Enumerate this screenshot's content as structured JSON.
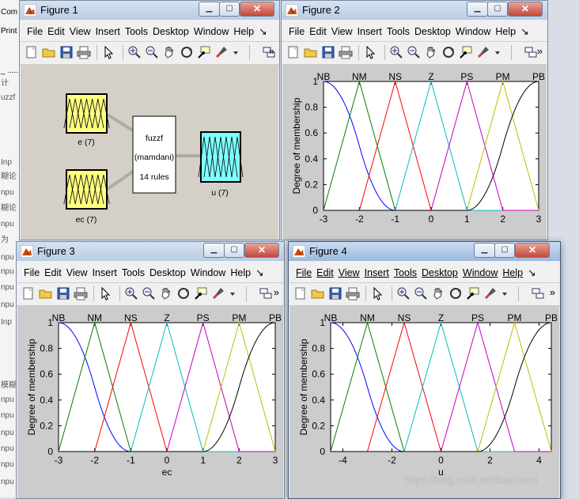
{
  "background": {
    "fragments": [
      "Com",
      "Print",
      "_ .....",
      "计",
      "uzzf",
      "Inp",
      "糊论",
      "npu",
      "糊论",
      "npu",
      "为",
      "npu",
      "npu",
      "npu",
      "npu",
      "Inp",
      "模糊",
      "npu",
      "npu",
      "npu",
      "npu",
      "npu",
      "npu"
    ]
  },
  "menu_items": [
    "File",
    "Edit",
    "View",
    "Insert",
    "Tools",
    "Desktop",
    "Window",
    "Help"
  ],
  "menu_overflow": "↘",
  "toolbar_overflow": "»",
  "windows": {
    "figure1": {
      "title": "Figure 1"
    },
    "figure2": {
      "title": "Figure 2"
    },
    "figure3": {
      "title": "Figure 3"
    },
    "figure4": {
      "title": "Figure 4"
    }
  },
  "fis_diagram": {
    "input1_label": "e (7)",
    "input2_label": "ec (7)",
    "system_name": "fuzzf",
    "system_type": "(mamdani)",
    "rules": "14 rules",
    "output_label": "u (7)",
    "input_color": "#ffff80",
    "output_color": "#80ffff"
  },
  "chart_data": [
    {
      "type": "line",
      "figure": "Figure 2",
      "xlabel": "",
      "ylabel": "Degree of membership",
      "xlim": [
        -3,
        3
      ],
      "ylim": [
        0,
        1
      ],
      "xticks": [
        "-3",
        "-2",
        "-1",
        "0",
        "1",
        "2",
        "3"
      ],
      "yticks": [
        "0",
        "0.2",
        "0.4",
        "0.6",
        "0.8",
        "1"
      ],
      "grid": false,
      "series": [
        {
          "name": "NB",
          "color": "#0000ff",
          "shape": "zmf",
          "params": [
            -3,
            -1
          ]
        },
        {
          "name": "NM",
          "color": "#008000",
          "shape": "trimf",
          "params": [
            -3,
            -2,
            -1
          ]
        },
        {
          "name": "NS",
          "color": "#ff0000",
          "shape": "trimf",
          "params": [
            -2,
            -1,
            0
          ]
        },
        {
          "name": "Z",
          "color": "#00bfbf",
          "shape": "trimf",
          "params": [
            -1,
            0,
            1
          ]
        },
        {
          "name": "PS",
          "color": "#bf00bf",
          "shape": "trimf",
          "params": [
            0,
            1,
            2
          ]
        },
        {
          "name": "PM",
          "color": "#bfbf00",
          "shape": "trimf",
          "params": [
            1,
            2,
            3
          ]
        },
        {
          "name": "PB",
          "color": "#000000",
          "shape": "smf",
          "params": [
            1,
            3
          ]
        }
      ]
    },
    {
      "type": "line",
      "figure": "Figure 3",
      "xlabel": "ec",
      "ylabel": "Degree of membership",
      "xlim": [
        -3,
        3
      ],
      "ylim": [
        0,
        1
      ],
      "xticks": [
        "-3",
        "-2",
        "-1",
        "0",
        "1",
        "2",
        "3"
      ],
      "yticks": [
        "0",
        "0.2",
        "0.4",
        "0.6",
        "0.8",
        "1"
      ],
      "grid": false,
      "series": [
        {
          "name": "NB",
          "color": "#0000ff",
          "shape": "zmf",
          "params": [
            -3,
            -1
          ]
        },
        {
          "name": "NM",
          "color": "#008000",
          "shape": "trimf",
          "params": [
            -3,
            -2,
            -1
          ]
        },
        {
          "name": "NS",
          "color": "#ff0000",
          "shape": "trimf",
          "params": [
            -2,
            -1,
            0
          ]
        },
        {
          "name": "Z",
          "color": "#00bfbf",
          "shape": "trimf",
          "params": [
            -1,
            0,
            1
          ]
        },
        {
          "name": "PS",
          "color": "#bf00bf",
          "shape": "trimf",
          "params": [
            0,
            1,
            2
          ]
        },
        {
          "name": "PM",
          "color": "#bfbf00",
          "shape": "trimf",
          "params": [
            1,
            2,
            3
          ]
        },
        {
          "name": "PB",
          "color": "#000000",
          "shape": "smf",
          "params": [
            1,
            3
          ]
        }
      ]
    },
    {
      "type": "line",
      "figure": "Figure 4",
      "xlabel": "u",
      "ylabel": "Degree of membership",
      "xlim": [
        -4.5,
        4.5
      ],
      "ylim": [
        0,
        1
      ],
      "xticks": [
        "-4",
        "-2",
        "0",
        "2",
        "4"
      ],
      "xtick_values": [
        -4,
        -2,
        0,
        2,
        4
      ],
      "yticks": [
        "0",
        "0.2",
        "0.4",
        "0.6",
        "0.8",
        "1"
      ],
      "grid": false,
      "series": [
        {
          "name": "NB",
          "color": "#0000ff",
          "shape": "zmf",
          "params": [
            -4.5,
            -1.5
          ]
        },
        {
          "name": "NM",
          "color": "#008000",
          "shape": "trimf",
          "params": [
            -4.5,
            -3,
            -1.5
          ]
        },
        {
          "name": "NS",
          "color": "#ff0000",
          "shape": "trimf",
          "params": [
            -3,
            -1.5,
            0
          ]
        },
        {
          "name": "Z",
          "color": "#00bfbf",
          "shape": "trimf",
          "params": [
            -1.5,
            0,
            1.5
          ]
        },
        {
          "name": "PS",
          "color": "#bf00bf",
          "shape": "trimf",
          "params": [
            0,
            1.5,
            3
          ]
        },
        {
          "name": "PM",
          "color": "#bfbf00",
          "shape": "trimf",
          "params": [
            1.5,
            3,
            4.5
          ]
        },
        {
          "name": "PB",
          "color": "#000000",
          "shape": "smf",
          "params": [
            1.5,
            4.5
          ]
        }
      ]
    }
  ],
  "watermark": "https://blog.csdn.net/buaixvexi"
}
